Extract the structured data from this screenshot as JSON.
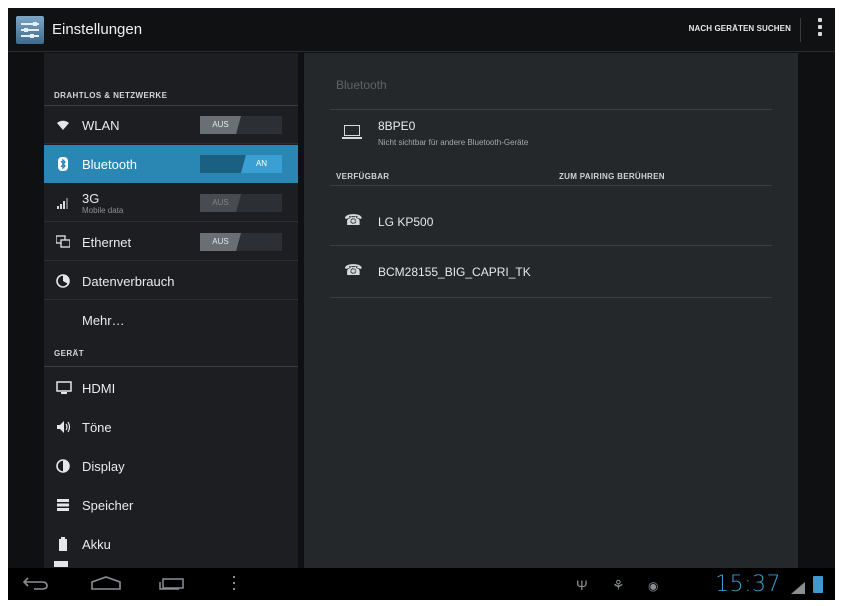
{
  "action_bar": {
    "title": "Einstellungen",
    "scan_button": "NACH GERÄTEN SUCHEN",
    "app_icon": "settings-sliders-icon",
    "overflow_icon": "overflow-menu-icon"
  },
  "sidebar": {
    "section_wireless": "DRAHTLOS & NETZWERKE",
    "section_device": "GERÄT",
    "items": [
      {
        "label": "WLAN",
        "icon": "wifi-icon",
        "toggle": "AUS"
      },
      {
        "label": "Bluetooth",
        "icon": "bluetooth-icon",
        "toggle": "AN"
      },
      {
        "label": "3G",
        "sublabel": "Mobile data",
        "icon": "signal-icon",
        "toggle": "AUS"
      },
      {
        "label": "Ethernet",
        "icon": "ethernet-icon",
        "toggle": "AUS"
      },
      {
        "label": "Datenverbrauch",
        "icon": "data-usage-icon"
      },
      {
        "label": "Mehr…"
      },
      {
        "label": "HDMI",
        "icon": "monitor-icon"
      },
      {
        "label": "Töne",
        "icon": "speaker-icon"
      },
      {
        "label": "Display",
        "icon": "brightness-icon"
      },
      {
        "label": "Speicher",
        "icon": "storage-icon"
      },
      {
        "label": "Akku",
        "icon": "battery-icon"
      }
    ]
  },
  "bluetooth_pane": {
    "title": "Bluetooth",
    "own_device": {
      "name": "8BPE0",
      "status": "Nicht sichtbar für andere Bluetooth-Geräte"
    },
    "available_label": "VERFÜGBAR",
    "pairing_hint": "ZUM PAIRING BERÜHREN",
    "devices": [
      {
        "name": "LG KP500",
        "icon": "phone-icon"
      },
      {
        "name": "BCM28155_BIG_CAPRI_TK",
        "icon": "phone-icon"
      }
    ]
  },
  "system_bar": {
    "clock": "15:37"
  },
  "colors": {
    "accent": "#2a86b3",
    "clock": "#3c9ad0",
    "background": "#0f1012",
    "panel": "#1c1e21"
  }
}
